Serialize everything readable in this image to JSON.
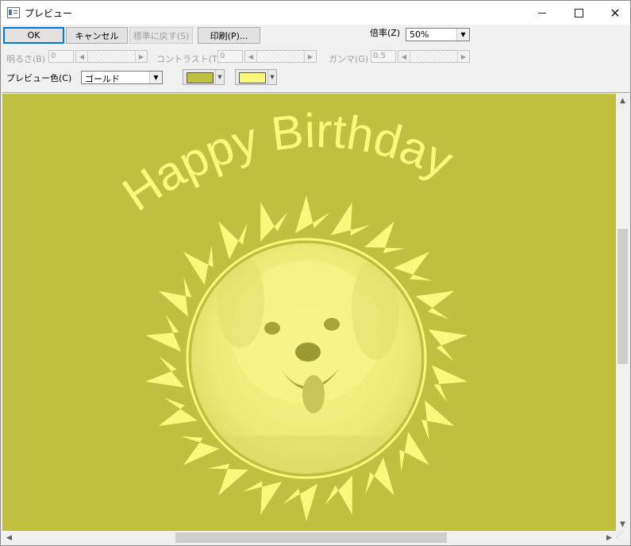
{
  "window": {
    "title": "プレビュー",
    "minimize_icon": "minimize-icon",
    "maximize_icon": "maximize-icon",
    "close_icon": "close-icon"
  },
  "toolbar": {
    "ok_label": "OK",
    "cancel_label": "キャンセル",
    "reset_label": "標準に戻す(S)",
    "print_label": "印刷(P)...",
    "zoom_label": "倍率(Z)",
    "zoom_value": "50%"
  },
  "adjust": {
    "brightness_label": "明るさ(B)",
    "brightness_value": "0",
    "contrast_label": "コントラスト(T)",
    "contrast_value": "0",
    "gamma_label": "ガンマ(G)",
    "gamma_value": "0.5"
  },
  "color": {
    "preview_color_label": "プレビュー色(C)",
    "preview_color_value": "ゴールド",
    "color1": "#c0c040",
    "color2": "#f8f87c"
  },
  "card": {
    "text": "Happy Birthday",
    "background_color": "#c0c040",
    "foreground_color": "#f8f87c"
  }
}
